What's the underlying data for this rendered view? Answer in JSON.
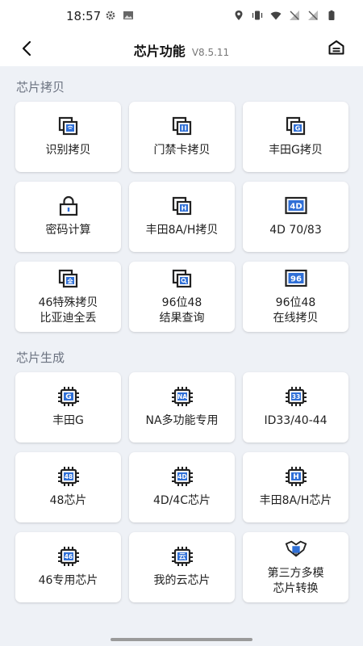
{
  "status": {
    "time": "18:57"
  },
  "header": {
    "title": "芯片功能",
    "version": "V8.5.11"
  },
  "sections": [
    {
      "title": "芯片拷贝",
      "items": [
        {
          "label": "识别拷贝",
          "icon": "copy-wifi-icon"
        },
        {
          "label": "门禁卡拷贝",
          "icon": "copy-card-icon"
        },
        {
          "label": "丰田G拷贝",
          "icon": "copy-g-icon"
        },
        {
          "label": "密码计算",
          "icon": "lock-icon"
        },
        {
          "label": "丰田8A/H拷贝",
          "icon": "copy-h-icon"
        },
        {
          "label": "4D 70/83",
          "icon": "4d-badge-icon"
        },
        {
          "label": "46特殊拷贝\n比亚迪全丢",
          "icon": "copy-quan-icon"
        },
        {
          "label": "96位48\n结果查询",
          "icon": "copy-search-icon"
        },
        {
          "label": "96位48\n在线拷贝",
          "icon": "96-badge-icon"
        }
      ]
    },
    {
      "title": "芯片生成",
      "items": [
        {
          "label": "丰田G",
          "icon": "chip-g-icon",
          "chip": "G"
        },
        {
          "label": "NA多功能专用",
          "icon": "chip-na-icon",
          "chip": "NA"
        },
        {
          "label": "ID33/40-44",
          "icon": "chip-33-icon",
          "chip": "33"
        },
        {
          "label": "48芯片",
          "icon": "chip-48-icon",
          "chip": "48"
        },
        {
          "label": "4D/4C芯片",
          "icon": "chip-4d-icon",
          "chip": "4D"
        },
        {
          "label": "丰田8A/H芯片",
          "icon": "chip-h-icon",
          "chip": "H"
        },
        {
          "label": "46专用芯片",
          "icon": "chip-46-icon",
          "chip": "46"
        },
        {
          "label": "我的云芯片",
          "icon": "chip-cloud-icon",
          "chip": "云"
        },
        {
          "label": "第三方多模\n芯片转换",
          "icon": "multi-chip-icon"
        }
      ]
    }
  ],
  "colors": {
    "accent": "#2f6fd6",
    "iconStroke": "#222222"
  }
}
